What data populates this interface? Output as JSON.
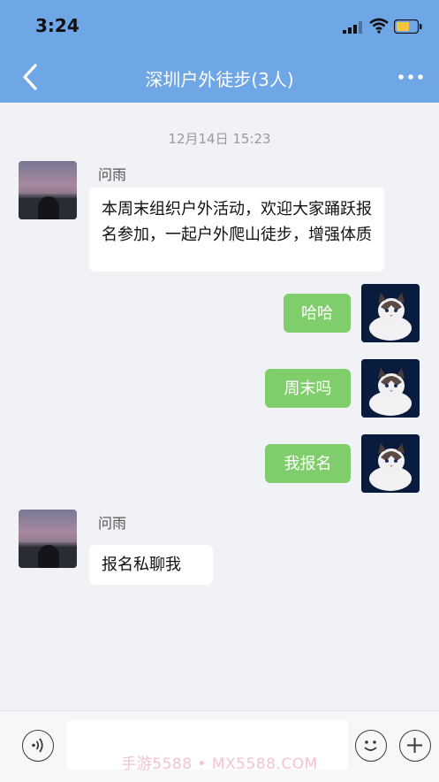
{
  "status": {
    "time": "3:24"
  },
  "nav": {
    "title": "深圳户外徒步(3人)"
  },
  "chat": {
    "timestamp": "12月14日 15:23",
    "messages": [
      {
        "side": "left",
        "sender": "问雨",
        "text": "本周末组织户外活动，欢迎大家踊跃报名参加，一起户外爬山徒步，增强体质"
      },
      {
        "side": "right",
        "text": "哈哈"
      },
      {
        "side": "right",
        "text": "周末吗"
      },
      {
        "side": "right",
        "text": "我报名"
      },
      {
        "side": "left",
        "sender": "问雨",
        "text": "报名私聊我"
      }
    ]
  },
  "footer": {
    "input_value": ""
  },
  "watermark": "手游5588 • MX5588.COM",
  "colors": {
    "header": "#6fa7e6",
    "bubble_right": "#7fce6b",
    "bubble_left": "#ffffff",
    "background": "#f1f2f6"
  }
}
